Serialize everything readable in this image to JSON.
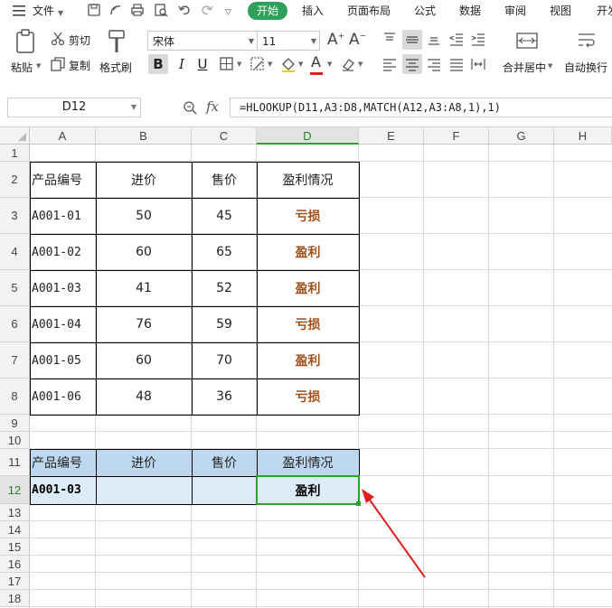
{
  "menu": {
    "file_label": "文件",
    "tabs": [
      {
        "label": "开始",
        "active": true
      },
      {
        "label": "插入"
      },
      {
        "label": "页面布局"
      },
      {
        "label": "公式"
      },
      {
        "label": "数据"
      },
      {
        "label": "审阅"
      },
      {
        "label": "视图"
      },
      {
        "label": "开发"
      }
    ]
  },
  "ribbon": {
    "paste_label": "粘贴",
    "cut_label": "剪切",
    "copy_label": "复制",
    "format_painter_label": "格式刷",
    "font_name": "宋体",
    "font_size": "11",
    "bold_label": "B",
    "italic_label": "I",
    "underline_label": "U",
    "merge_center_label": "合并居中",
    "wrap_text_label": "自动换行",
    "font_color": "#e02020"
  },
  "formula_bar": {
    "cell_ref": "D12",
    "fx_label": "fx",
    "formula": "=HLOOKUP(D11,A3:D8,MATCH(A12,A3:A8,1),1)"
  },
  "sheet": {
    "columns": [
      "A",
      "B",
      "C",
      "D",
      "E",
      "F",
      "G",
      "H"
    ],
    "rows": [
      "1",
      "2",
      "3",
      "4",
      "5",
      "6",
      "7",
      "8",
      "9",
      "10",
      "11",
      "12",
      "13",
      "14",
      "15",
      "16",
      "17",
      "18"
    ],
    "table": {
      "headers": [
        "产品编号",
        "进价",
        "售价",
        "盈利情况"
      ],
      "rows": [
        [
          "A001-01",
          "50",
          "45",
          "亏损"
        ],
        [
          "A001-02",
          "60",
          "65",
          "盈利"
        ],
        [
          "A001-03",
          "41",
          "52",
          "盈利"
        ],
        [
          "A001-04",
          "76",
          "59",
          "亏损"
        ],
        [
          "A001-05",
          "60",
          "70",
          "盈利"
        ],
        [
          "A001-06",
          "48",
          "36",
          "亏损"
        ]
      ]
    },
    "lookup": {
      "headers": [
        "产品编号",
        "进价",
        "售价",
        "盈利情况"
      ],
      "row": [
        "A001-03",
        "",
        "",
        "盈利"
      ]
    },
    "selected_cell": "D12",
    "colors": {
      "header_fill": "#bdd7ee",
      "lookup_fill": "#ddebf7",
      "selection": "#2ea12e",
      "result_text": "#a0501e",
      "arrow": "#e02020"
    }
  }
}
